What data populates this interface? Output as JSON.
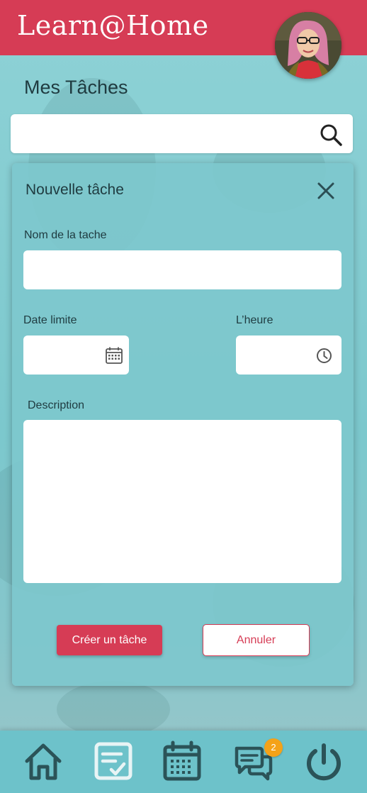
{
  "app": {
    "title": "Learn@Home"
  },
  "header": {
    "avatar_icon": "user-avatar"
  },
  "page": {
    "title": "Mes Tâches"
  },
  "search": {
    "placeholder": "",
    "value": "",
    "icon": "search-icon"
  },
  "new_task": {
    "title": "Nouvelle tâche",
    "close_icon": "close-icon",
    "task_name_label": "Nom de la tache",
    "task_name_value": "",
    "due_date_label": "Date limite",
    "due_date_value": "",
    "due_date_icon": "calendar-icon",
    "time_label": "L’heure",
    "time_value": "",
    "time_icon": "clock-icon",
    "description_label": "Description",
    "description_value": "",
    "create_label": "Créer un tâche",
    "cancel_label": "Annuler"
  },
  "bottom_nav": {
    "items": [
      {
        "icon": "home-icon"
      },
      {
        "icon": "tasks-icon",
        "active": true
      },
      {
        "icon": "calendar-icon"
      },
      {
        "icon": "chat-icon",
        "badge": "2"
      },
      {
        "icon": "power-icon"
      }
    ]
  },
  "colors": {
    "brand_red": "#d63c55",
    "teal_background": "#7cc9cf",
    "dark_icon": "#2b5358",
    "badge_orange": "#f4a218"
  }
}
